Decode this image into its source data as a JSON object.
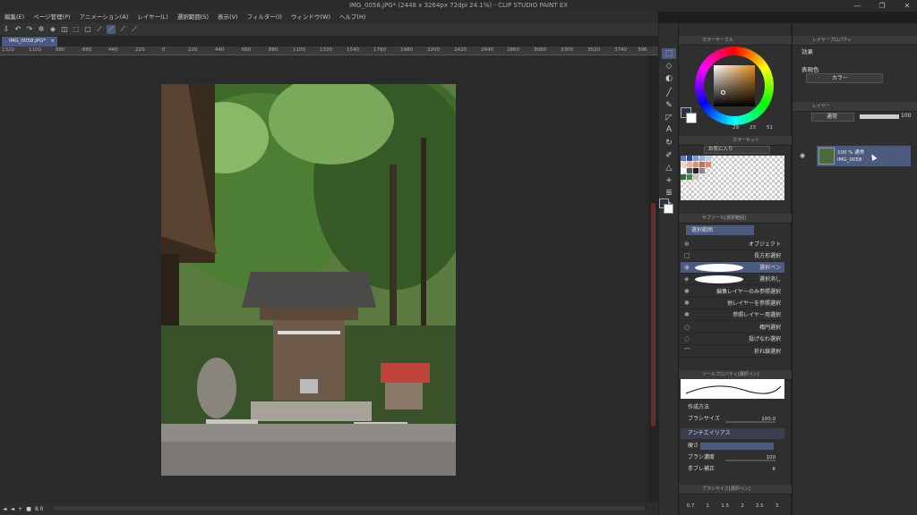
{
  "title": "IMG_0058.JPG* (2448 x 3264px 72dpi 24.1%)  - CLIP STUDIO PAINT EX",
  "window_controls": [
    "—",
    "❐",
    "✕"
  ],
  "menu": [
    "編集(E)",
    "ページ管理(P)",
    "アニメーション(A)",
    "レイヤー(L)",
    "選択範囲(S)",
    "表示(V)",
    "フィルター(I)",
    "ウィンドウ(W)",
    "ヘルプ(H)"
  ],
  "document_tab": {
    "label": "IMG_0058.JPG*",
    "close": "×"
  },
  "ruler": [
    "1320",
    "1100",
    "880",
    "660",
    "440",
    "220",
    "0",
    "220",
    "440",
    "660",
    "880",
    "1100",
    "1320",
    "1540",
    "1760",
    "1980",
    "2200",
    "2420",
    "2640",
    "2860",
    "3080",
    "3300",
    "3520",
    "3740",
    "396"
  ],
  "status": {
    "zoom": "8.0",
    "nav": [
      "◄",
      "◄",
      "+",
      "■"
    ]
  },
  "color_panel": {
    "header": "カラーサークル",
    "values": [
      "29",
      "23",
      "51"
    ],
    "accent": "#e08a1e"
  },
  "color_set": {
    "header": "カラーセット",
    "palette": "お気に入り"
  },
  "sub_tool": {
    "header": "サブツール[選択範囲]",
    "group": "選択範囲",
    "items": [
      {
        "label": "オブジェクト",
        "icon": "arrow-icon"
      },
      {
        "label": "長方形選択",
        "icon": "rect-icon"
      },
      {
        "label": "選択ペン",
        "icon": "pen-icon"
      },
      {
        "label": "選択消し",
        "icon": "eraser-icon"
      },
      {
        "label": "編集レイヤーのみ参照選択",
        "icon": "wand-icon"
      },
      {
        "label": "他レイヤーを参照選択",
        "icon": "wand-icon"
      },
      {
        "label": "参照レイヤー用選択",
        "icon": "wand-icon"
      },
      {
        "label": "楕円選択",
        "icon": "ellipse-icon"
      },
      {
        "label": "投げなわ選択",
        "icon": "lasso-icon"
      },
      {
        "label": "折れ線選択",
        "icon": "polyline-icon"
      }
    ]
  },
  "tool_property": {
    "header": "ツールプロパティ[選択ペン]",
    "rows": [
      {
        "label": "作成方法",
        "value": ""
      },
      {
        "label": "ブラシサイズ",
        "value": "100.0"
      },
      {
        "label": "アンチエイリアス",
        "value": ""
      },
      {
        "label": "硬さ",
        "value": ""
      },
      {
        "label": "ブラシ濃度",
        "value": "100"
      },
      {
        "label": "手ブレ補正",
        "value": "6"
      }
    ]
  },
  "brush_size_panel": {
    "header": "ブラシサイズ[選択ペン]",
    "sizes": [
      "0.7",
      "1",
      "1.5",
      "2",
      "2.5",
      "3"
    ]
  },
  "layer_property": {
    "header": "レイヤープロパティ",
    "effect_label": "効果",
    "express_label": "表現色",
    "express_value": "カラー"
  },
  "layer_panel": {
    "header": "レイヤー",
    "blend_mode": "通常",
    "opacity": "100",
    "layer": {
      "percent_mode": "100 % 通常",
      "name": "IMG_0058"
    }
  }
}
